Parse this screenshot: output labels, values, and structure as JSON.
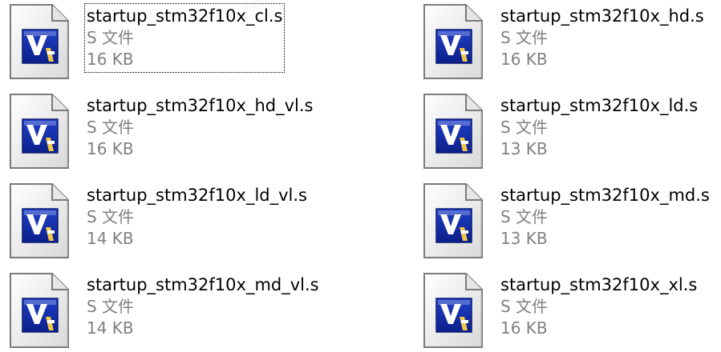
{
  "selected_index": 0,
  "files": [
    {
      "name": "startup_stm32f10x_cl.s",
      "type": "S 文件",
      "size": "16 KB",
      "icon": "visual-studio-source-file-icon"
    },
    {
      "name": "startup_stm32f10x_hd.s",
      "type": "S 文件",
      "size": "16 KB",
      "icon": "visual-studio-source-file-icon"
    },
    {
      "name": "startup_stm32f10x_hd_vl.s",
      "type": "S 文件",
      "size": "16 KB",
      "icon": "visual-studio-source-file-icon"
    },
    {
      "name": "startup_stm32f10x_ld.s",
      "type": "S 文件",
      "size": "13 KB",
      "icon": "visual-studio-source-file-icon"
    },
    {
      "name": "startup_stm32f10x_ld_vl.s",
      "type": "S 文件",
      "size": "14 KB",
      "icon": "visual-studio-source-file-icon"
    },
    {
      "name": "startup_stm32f10x_md.s",
      "type": "S 文件",
      "size": "13 KB",
      "icon": "visual-studio-source-file-icon"
    },
    {
      "name": "startup_stm32f10x_md_vl.s",
      "type": "S 文件",
      "size": "14 KB",
      "icon": "visual-studio-source-file-icon"
    },
    {
      "name": "startup_stm32f10x_xl.s",
      "type": "S 文件",
      "size": "16 KB",
      "icon": "visual-studio-source-file-icon"
    }
  ],
  "colors": {
    "name_text": "#000000",
    "detail_text": "#808080",
    "icon_blue": "#1f40c8",
    "icon_blue_dark": "#0c1f8a",
    "page_fold": "#e6e6e6"
  }
}
